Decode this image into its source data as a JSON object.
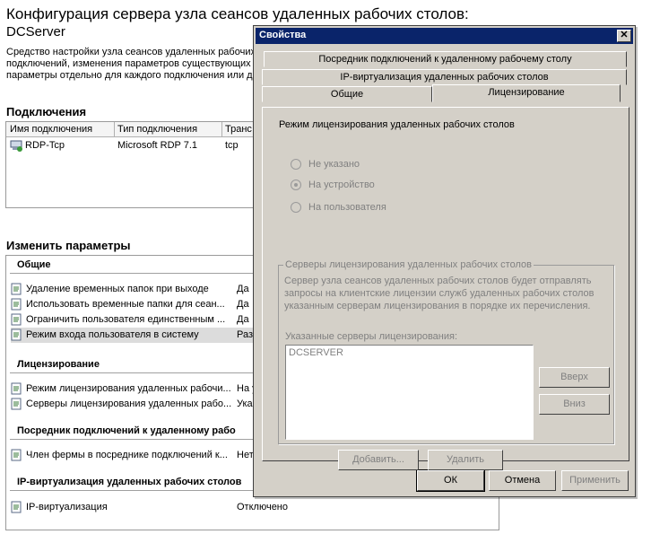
{
  "background": {
    "title": "Конфигурация сервера узла сеансов удаленных рабочих столов:",
    "server": "DCServer",
    "description": [
      "Средство настройки узла сеансов удаленных рабочих",
      "подключений, изменения параметров существующих",
      "параметры отдельно для каждого подключения или д"
    ],
    "connections_heading": "Подключения",
    "connections_columns": [
      "Имя подключения",
      "Тип подключения",
      "Транс"
    ],
    "connection_row": {
      "name": "RDP-Tcp",
      "type": "Microsoft RDP 7.1",
      "transport": "tcp"
    },
    "params_heading": "Изменить параметры",
    "groups": {
      "general": "Общие",
      "licensing": "Лицензирование",
      "broker": "Посредник подключений к удаленному рабо",
      "ipv": "IP-виртуализация удаленных рабочих столов"
    },
    "rows": [
      {
        "name": "Удаление временных папок при выходе",
        "value": "Да"
      },
      {
        "name": "Использовать временные папки для сеан...",
        "value": "Да"
      },
      {
        "name": "Ограничить пользователя единственным ...",
        "value": "Да"
      },
      {
        "name": "Режим входа пользователя в систему",
        "value": "Раз"
      },
      {
        "name": "Режим лицензирования удаленных рабочи...",
        "value": "На у"
      },
      {
        "name": "Серверы лицензирования удаленных рабо...",
        "value": "Ука"
      },
      {
        "name": "Член фермы в посреднике подключений к...",
        "value": "Нет"
      },
      {
        "name": "IP-виртуализация",
        "value": "Отключено"
      }
    ]
  },
  "dialog": {
    "title": "Свойства",
    "close": "✕",
    "tabs": [
      "Посредник подключений к удаленному рабочему столу",
      "IP-виртуализация удаленных рабочих столов",
      "Общие",
      "Лицензирование"
    ],
    "mode_label": "Режим лицензирования удаленных рабочих столов",
    "radios": [
      {
        "label": "Не указано",
        "checked": false
      },
      {
        "label": "На устройство",
        "checked": true
      },
      {
        "label": "На пользователя",
        "checked": false
      }
    ],
    "group_title": "Серверы лицензирования удаленных рабочих столов",
    "group_desc": [
      "Сервер узла сеансов удаленных рабочих столов будет отправлять",
      "запросы на клиентские лицензии служб удаленных рабочих столов",
      "указанным серверам лицензирования в порядке их перечисления."
    ],
    "servers_label": "Указанные серверы лицензирования:",
    "servers": [
      "DCSERVER"
    ],
    "buttons": {
      "up": "Вверх",
      "down": "Вниз",
      "add": "Добавить...",
      "remove": "Удалить",
      "ok": "ОК",
      "cancel": "Отмена",
      "apply": "Применить"
    }
  }
}
